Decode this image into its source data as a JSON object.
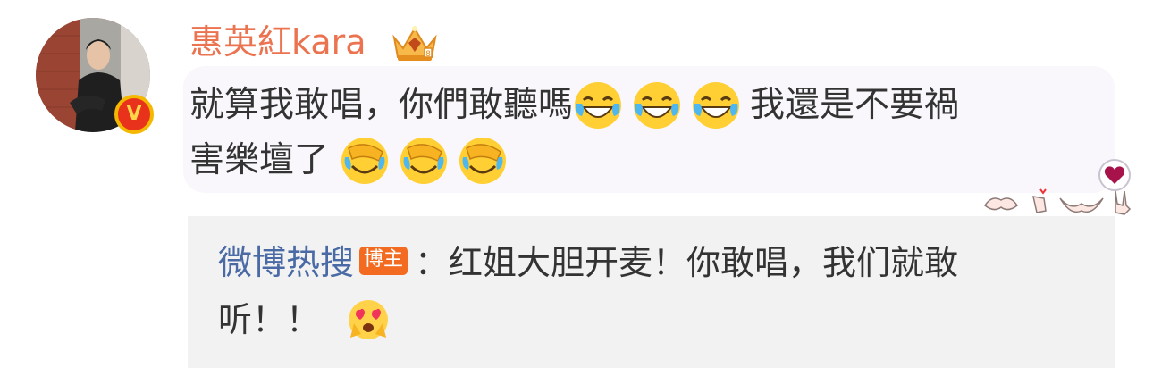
{
  "post": {
    "author": {
      "name": "惠英紅kara",
      "verified_badge": "V",
      "crown_icon": "crown-icon"
    },
    "text_line1": "就算我敢唱，你們敢聽嗎",
    "text_line1_after": "我還是不要禍",
    "text_line2": "害樂壇了",
    "emojis_line1": [
      "laugh-cry-icon",
      "laugh-cry-icon",
      "laugh-cry-icon"
    ],
    "emojis_line2": [
      "facepalm-cry-icon",
      "facepalm-cry-icon",
      "facepalm-cry-icon"
    ],
    "reaction_icons": [
      "heart-badge-icon",
      "heart-hands-icon",
      "finger-heart-icon",
      "hug-hands-icon",
      "rock-hand-icon"
    ]
  },
  "repost": {
    "author": "微博热搜",
    "tag": "博主",
    "text_line1": "：红姐大胆开麦！你敢唱，我们就敢",
    "text_line2": "听！！",
    "emoji": "heart-eyes-icon"
  },
  "colors": {
    "username": "#eb7350",
    "repost_name": "#4a6aa5",
    "tag": "#f36b21",
    "text": "#333333"
  }
}
